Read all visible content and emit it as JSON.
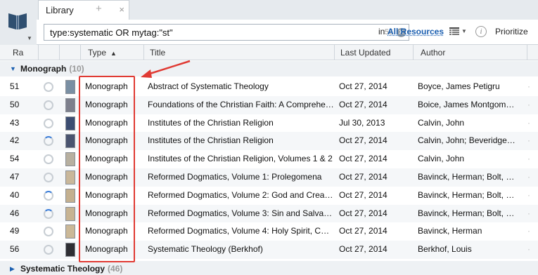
{
  "app": {
    "tab_label": "Library",
    "tab_close": "×",
    "tab_add": "+"
  },
  "toolbar": {
    "search_value": "type:systematic  OR mytag:\"st\"",
    "search_count": "56",
    "scope_prefix": "in",
    "scope_link": "All Resources",
    "prioritize_label": "Prioritize",
    "info_label": "i"
  },
  "columns": {
    "rating": "Ra",
    "type": "Type",
    "title": "Title",
    "last_updated": "Last Updated",
    "author": "Author"
  },
  "groups": [
    {
      "label": "Monograph",
      "count": "(10)"
    },
    {
      "label": "Systematic Theology",
      "count": "(46)"
    }
  ],
  "rows": [
    {
      "rating": "51",
      "type": "Monograph",
      "title": "Abstract of Systematic Theology",
      "updated": "Oct 27, 2014",
      "author": "Boyce, James Petigru",
      "cover": "#7a8fa3",
      "status_partial": false
    },
    {
      "rating": "50",
      "type": "Monograph",
      "title": "Foundations of the Christian Faith: A Comprehe…",
      "updated": "Oct 27, 2014",
      "author": "Boice, James Montgom…",
      "cover": "#7d7f8c",
      "status_partial": false
    },
    {
      "rating": "43",
      "type": "Monograph",
      "title": "Institutes of the Christian Religion",
      "updated": "Jul 30, 2013",
      "author": "Calvin, John",
      "cover": "#3d4e72",
      "status_partial": false
    },
    {
      "rating": "42",
      "type": "Monograph",
      "title": "Institutes of the Christian Religion",
      "updated": "Oct 27, 2014",
      "author": "Calvin, John; Beveridge…",
      "cover": "#4a5470",
      "status_partial": true
    },
    {
      "rating": "54",
      "type": "Monograph",
      "title": "Institutes of the Christian Religion, Volumes 1 & 2",
      "updated": "Oct 27, 2014",
      "author": "Calvin, John",
      "cover": "#b8b0a0",
      "status_partial": false
    },
    {
      "rating": "47",
      "type": "Monograph",
      "title": "Reformed Dogmatics, Volume 1: Prolegomena",
      "updated": "Oct 27, 2014",
      "author": "Bavinck, Herman; Bolt, …",
      "cover": "#c9b79a",
      "status_partial": false
    },
    {
      "rating": "40",
      "type": "Monograph",
      "title": "Reformed Dogmatics, Volume 2: God and Crea…",
      "updated": "Oct 27, 2014",
      "author": "Bavinck, Herman; Bolt, …",
      "cover": "#c4b08f",
      "status_partial": true
    },
    {
      "rating": "46",
      "type": "Monograph",
      "title": "Reformed Dogmatics, Volume 3: Sin and Salva…",
      "updated": "Oct 27, 2014",
      "author": "Bavinck, Herman; Bolt, …",
      "cover": "#c7b392",
      "status_partial": true
    },
    {
      "rating": "49",
      "type": "Monograph",
      "title": "Reformed Dogmatics, Volume 4: Holy Spirit, C…",
      "updated": "Oct 27, 2014",
      "author": "Bavinck, Herman",
      "cover": "#cbb897",
      "status_partial": false
    },
    {
      "rating": "56",
      "type": "Monograph",
      "title": "Systematic Theology (Berkhof)",
      "updated": "Oct 27, 2014",
      "author": "Berkhof, Louis",
      "cover": "#2e2e33",
      "status_partial": false
    }
  ],
  "colors": {
    "accent": "#1b5fb0",
    "annotation": "#e03a33"
  }
}
